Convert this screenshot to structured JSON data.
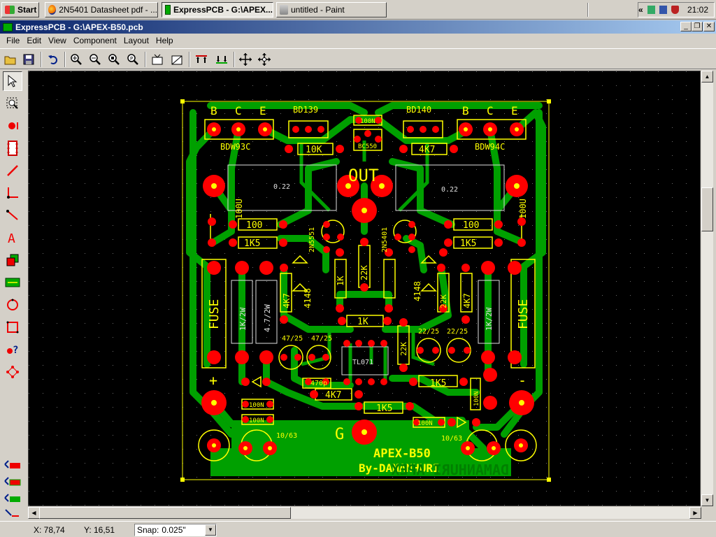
{
  "taskbar": {
    "start_label": "Start",
    "tasks": [
      {
        "label": "2N5401 Datasheet pdf - ...",
        "icon": "firefox-icon"
      },
      {
        "label": "ExpressPCB - G:\\APEX...",
        "icon": "expresspcb-icon",
        "active": true
      },
      {
        "label": "untitled - Paint",
        "icon": "paint-icon"
      }
    ],
    "tray_chevron": "«",
    "clock": "21:02"
  },
  "window": {
    "title": "ExpressPCB - G:\\APEX-B50.pcb",
    "controls": [
      "_",
      "❐",
      "✕"
    ]
  },
  "menu": [
    "File",
    "Edit",
    "View",
    "Component",
    "Layout",
    "Help"
  ],
  "toolbar": {
    "tools": [
      "open-icon",
      "save-icon",
      "undo-icon",
      "zoom-in-icon",
      "zoom-out-icon",
      "zoom-fit-icon",
      "zoom-previous-icon",
      "component-properties-icon",
      "pad-properties-icon",
      "traces-top-icon",
      "traces-bottom-icon",
      "move-icon",
      "align-icon"
    ]
  },
  "palette": {
    "tools": [
      "select-icon",
      "zoom-icon",
      "pad-icon",
      "component-icon",
      "trace-icon",
      "corner-icon",
      "line-icon",
      "text-icon",
      "layer-icon",
      "pcb-icon",
      "circle-icon",
      "rectangle-icon",
      "query-icon",
      "netlist-icon"
    ],
    "layers": [
      "layer-top-icon",
      "layer-bottom-icon",
      "layer-silk-icon",
      "layer-route-icon"
    ]
  },
  "pcb": {
    "silk_top": [
      "B",
      "C",
      "E",
      "BD139",
      "100N",
      "BD140",
      "B",
      "C",
      "E"
    ],
    "labels": {
      "bdw93c": "BDW93C",
      "bdw94c": "BDW94C",
      "bc550": "BC550",
      "r10k": "10K",
      "r4k7_top": "4K7",
      "out": "OUT",
      "r022_left": "0.22",
      "r022_right": "0.22",
      "r100_left": "100",
      "r100_right": "100",
      "r1k5_left": "1K5",
      "r1k5_right": "1K5",
      "c100u_left": "100U",
      "c100u_right": "100U",
      "q2n5551": "2N5551",
      "q2n5401": "2N5401",
      "r22k": "22K",
      "r4k7_left": "4K7",
      "r4k7_right": "4K7",
      "d4148_left": "4148",
      "d4148_right": "4148",
      "r1k_mid": "1K",
      "fuse_left": "FUSE",
      "fuse_right": "FUSE",
      "r1k2w_left": "1K/2W",
      "r1k2w_right": "1K/2W",
      "r47_2w": "4.7/2W",
      "c47_25_a": "47/25",
      "c47_25_b": "47/25",
      "c22_25_a": "22/25",
      "c22_25_b": "22/25",
      "r22k_2": "22K",
      "r22_vert": "22K",
      "tl071": "TL071",
      "c470p": "470p",
      "r4k7_bottom": "4K7",
      "r1k5_bottom_a": "1K5",
      "r1k5_bottom_b": "1K5",
      "c100n_a": "100N",
      "c100n_b": "100N",
      "c100n_c": "100N",
      "c100n_vert": "100N",
      "plus": "+",
      "minus": "-",
      "g": "G",
      "cap_10_63_left": "10/63",
      "cap_10_63_right": "10/63",
      "title": "APEX-B50",
      "author": "By-DAMANHURI",
      "mirror_text": "DAMANHURI  APEX"
    }
  },
  "status": {
    "x": "X: 78,74",
    "y": "Y: 16,51",
    "snap_label": "Snap:",
    "snap_value": "0.025\""
  },
  "colors": {
    "board": "#00a000",
    "pad": "#ff0000",
    "silk": "#ffff00",
    "canvas": "#000000",
    "grid": "#5a5a5a"
  }
}
